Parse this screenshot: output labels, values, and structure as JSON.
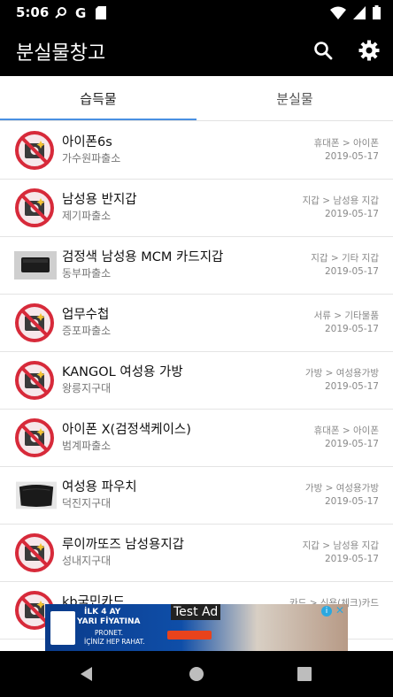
{
  "status_bar": {
    "time": "5:06",
    "icons": [
      "search-icon",
      "google-icon",
      "sd-card-icon",
      "wifi-icon",
      "signal-icon",
      "battery-icon"
    ]
  },
  "app_bar": {
    "title": "분실물창고",
    "actions": [
      "search-icon",
      "gear-icon"
    ]
  },
  "tabs": [
    {
      "label": "습득물",
      "active": true
    },
    {
      "label": "분실물",
      "active": false
    }
  ],
  "items": [
    {
      "title": "아이폰6s",
      "subtitle": "가수원파출소",
      "category": "휴대폰 > 아이폰",
      "date": "2019-05-17",
      "thumb": "no-photo-icon"
    },
    {
      "title": "남성용 반지갑",
      "subtitle": "제기파출소",
      "category": "지갑 > 남성용 지갑",
      "date": "2019-05-17",
      "thumb": "no-photo-icon"
    },
    {
      "title": "검정색 남성용 MCM 카드지갑",
      "subtitle": "동부파출소",
      "category": "지갑 > 기타 지갑",
      "date": "2019-05-17",
      "thumb": "wallet-photo"
    },
    {
      "title": "업무수첩",
      "subtitle": "증포파출소",
      "category": "서류 > 기타물품",
      "date": "2019-05-17",
      "thumb": "no-photo-icon"
    },
    {
      "title": "KANGOL 여성용 가방",
      "subtitle": "왕릉지구대",
      "category": "가방 > 여성용가방",
      "date": "2019-05-17",
      "thumb": "no-photo-icon"
    },
    {
      "title": "아이폰 X(검정색케이스)",
      "subtitle": "범계파출소",
      "category": "휴대폰 > 아이폰",
      "date": "2019-05-17",
      "thumb": "no-photo-icon"
    },
    {
      "title": "여성용 파우치",
      "subtitle": "덕진지구대",
      "category": "가방 > 여성용가방",
      "date": "2019-05-17",
      "thumb": "pouch-photo"
    },
    {
      "title": "루이까또즈 남성용지갑",
      "subtitle": "성내지구대",
      "category": "지갑 > 남성용 지갑",
      "date": "2019-05-17",
      "thumb": "no-photo-icon"
    },
    {
      "title": "kb국민카드",
      "subtitle": "",
      "category": "카드 > 신용(체크)카드",
      "date": "",
      "thumb": "no-photo-icon"
    }
  ],
  "ad": {
    "label": "Test Ad",
    "line1": "İLK 4 AY",
    "line2": "YARI FİYATINA",
    "line3": "PRONET.",
    "line4": "İÇİNİZ HEP RAHAT.",
    "info_icon": "info-icon",
    "close_icon": "close-icon"
  },
  "nav_bar": {
    "buttons": [
      "back-icon",
      "home-icon",
      "recents-icon"
    ]
  },
  "colors": {
    "bar": "#000000",
    "accent": "#4a90e2",
    "no_photo_red": "#d72a3a"
  }
}
